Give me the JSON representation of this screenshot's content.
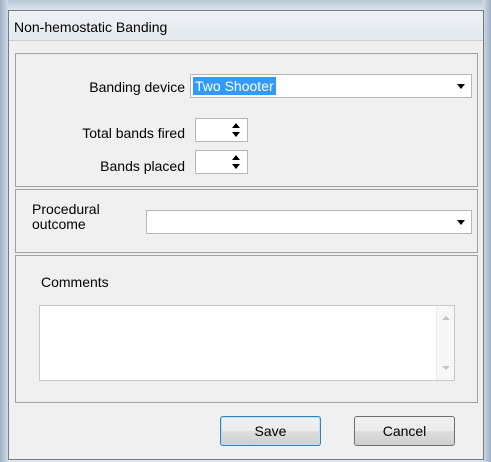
{
  "window": {
    "title": "Non-hemostatic Banding"
  },
  "banding": {
    "device_label": "Banding device",
    "device_value": "Two Shooter",
    "total_bands_label": "Total bands fired",
    "total_bands_value": "",
    "bands_placed_label": "Bands placed",
    "bands_placed_value": ""
  },
  "outcome": {
    "label_line1": "Procedural",
    "label_line2": "outcome",
    "value": ""
  },
  "comments": {
    "label": "Comments",
    "value": ""
  },
  "buttons": {
    "save": "Save",
    "cancel": "Cancel"
  }
}
